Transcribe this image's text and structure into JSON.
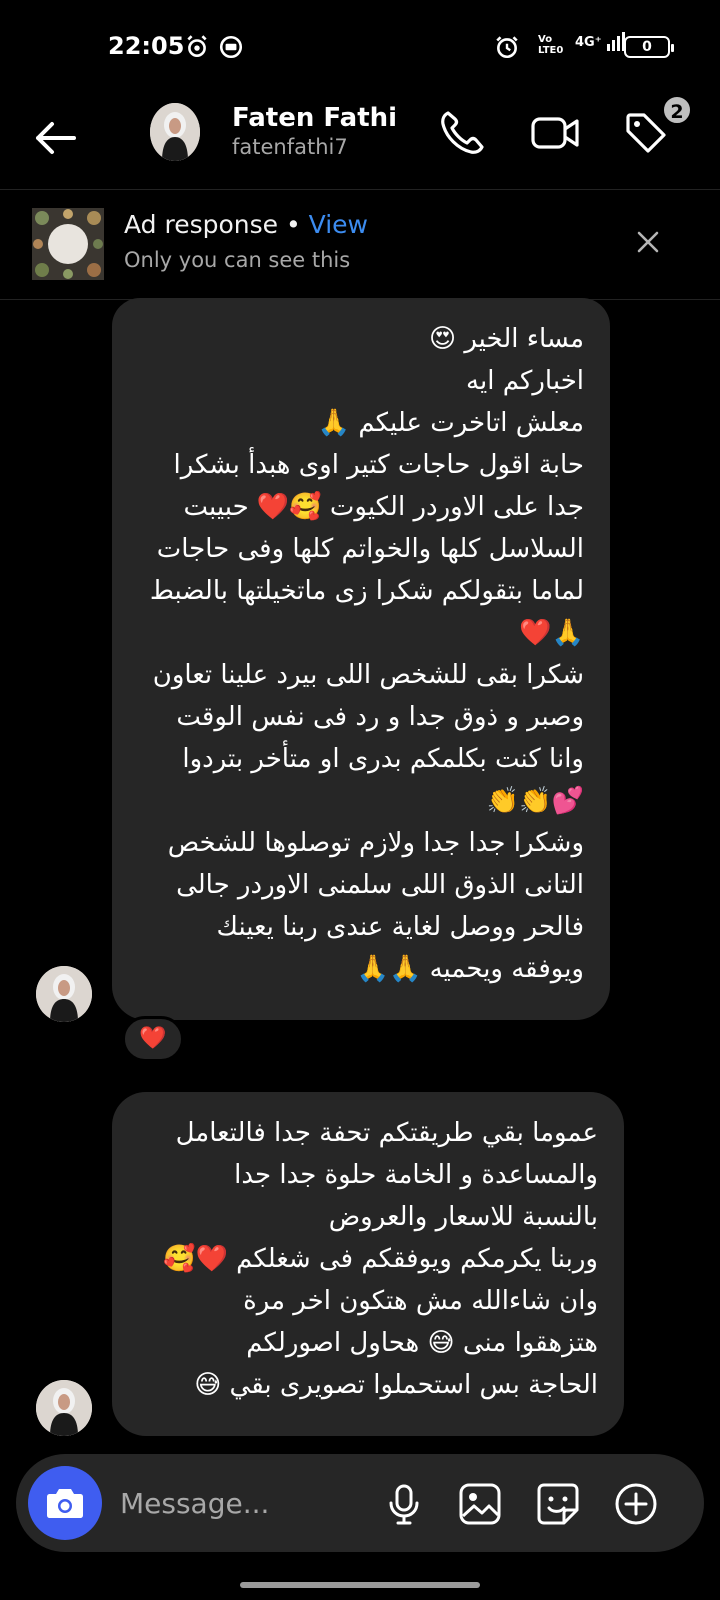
{
  "status_bar": {
    "time": "22:05",
    "network_top": "Vo",
    "network_bottom": "LTE0",
    "signal": "4G⁺",
    "battery": "0",
    "icons": [
      "alarm-icon",
      "screen-record-icon",
      "alarm-clock-icon",
      "volte-icon",
      "signal-icon",
      "battery-icon"
    ]
  },
  "header": {
    "name": "Faten Fathi",
    "username": "fatenfathi7",
    "badge_count": "2",
    "icons": [
      "back-arrow-icon",
      "phone-icon",
      "video-icon",
      "tag-icon"
    ]
  },
  "ad_response": {
    "title": "Ad response",
    "separator": " • ",
    "view_label": "View",
    "subtitle": "Only you can see this"
  },
  "messages": [
    {
      "text": "مساء الخير 😍\nاخباركم ايه\nمعلش اتاخرت عليكم 🙏\nحابة اقول حاجات كتير اوى هبدأ بشكرا\nجدا على الاوردر الكيوت 🥰❤️ حبيبت\nالسلاسل كلها والخواتم كلها وفى حاجات\nلماما بتقولكم شكرا زى ماتخيلتها بالضبط\n🙏❤️\nشكرا بقى للشخص اللى بيرد علينا تعاون\nوصبر و ذوق جدا و رد فى نفس الوقت\nوانا كنت بكلمكم بدرى او متأخر بتردوا\n💕👏👏\nوشكرا جدا جدا ولازم توصلوها للشخص\nالتانى الذوق اللى سلمنى الاوردر جالى\nفالحر ووصل لغاية عندى ربنا يعينك\nويوفقه ويحميه 🙏🙏",
      "reaction": "❤️"
    },
    {
      "text": "عموما بقي طريقتكم تحفة جدا فالتعامل\nوالمساعدة و الخامة حلوة جدا جدا\nبالنسبة للاسعار والعروض\nوربنا يكرمكم ويوفقكم فى شغلكم ❤️🥰\nوان شاءالله مش هتكون اخر مرة\nهتزهقوا منى 😅 هحاول اصورلكم\nالحاجة بس استحملوا تصويرى بقي 😅"
    }
  ],
  "composer": {
    "placeholder": "Message...",
    "icons": [
      "camera-icon",
      "microphone-icon",
      "gallery-icon",
      "sticker-icon",
      "add-icon"
    ]
  },
  "colors": {
    "background": "#000000",
    "bubble": "#262626",
    "accent_blue": "#3c8cf0",
    "camera_button": "#3f5df0",
    "secondary_text": "#a8a8a8"
  }
}
